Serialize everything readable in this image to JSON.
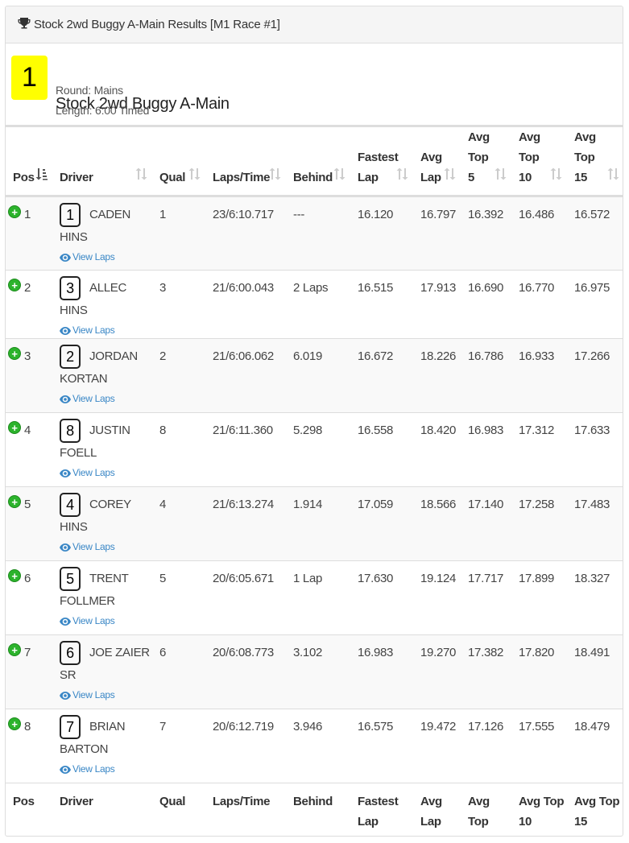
{
  "header": {
    "title": "Stock 2wd Buggy A-Main Results [M1 Race #1]",
    "icon": "trophy-icon"
  },
  "race": {
    "position_badge": "1",
    "badge_color": "#ffff00",
    "name": "Stock 2wd Buggy A-Main",
    "round": "Round: Mains",
    "length": "Length: 6:00 Timed"
  },
  "table": {
    "columns": [
      {
        "line1": "",
        "line2": "",
        "line3": "Pos"
      },
      {
        "line1": "",
        "line2": "",
        "line3": "Driver"
      },
      {
        "line1": "",
        "line2": "",
        "line3": "Qual"
      },
      {
        "line1": "",
        "line2": "",
        "line3": "Laps/Time"
      },
      {
        "line1": "",
        "line2": "",
        "line3": "Behind"
      },
      {
        "line1": "",
        "line2": "Fastest",
        "line3": "Lap"
      },
      {
        "line1": "",
        "line2": "Avg",
        "line3": "Lap"
      },
      {
        "line1": "Avg",
        "line2": "Top",
        "line3": "5"
      },
      {
        "line1": "Avg",
        "line2": "Top",
        "line3": "10"
      },
      {
        "line1": "Avg",
        "line2": "Top",
        "line3": "15"
      }
    ],
    "footer": [
      {
        "line1": "Pos",
        "line2": ""
      },
      {
        "line1": "Driver",
        "line2": ""
      },
      {
        "line1": "Qual",
        "line2": ""
      },
      {
        "line1": "Laps/Time",
        "line2": ""
      },
      {
        "line1": "Behind",
        "line2": ""
      },
      {
        "line1": "Fastest",
        "line2": "Lap"
      },
      {
        "line1": "Avg",
        "line2": "Lap"
      },
      {
        "line1": "Avg Top",
        "line2": "5"
      },
      {
        "line1": "Avg Top",
        "line2": "10"
      },
      {
        "line1": "Avg Top",
        "line2": "15"
      }
    ],
    "view_laps_label": "View Laps",
    "rows": [
      {
        "pos": "1",
        "car": "1",
        "driver": "CADEN HINS",
        "qual": "1",
        "laps": "23/6:10.717",
        "behind": "---",
        "fastest": "16.120",
        "avg": "16.797",
        "top5": "16.392",
        "top10": "16.486",
        "top15": "16.572"
      },
      {
        "pos": "2",
        "car": "3",
        "driver": "ALLEC HINS",
        "qual": "3",
        "laps": "21/6:00.043",
        "behind": "2 Laps",
        "fastest": "16.515",
        "avg": "17.913",
        "top5": "16.690",
        "top10": "16.770",
        "top15": "16.975"
      },
      {
        "pos": "3",
        "car": "2",
        "driver": "JORDAN KORTAN",
        "qual": "2",
        "laps": "21/6:06.062",
        "behind": "6.019",
        "fastest": "16.672",
        "avg": "18.226",
        "top5": "16.786",
        "top10": "16.933",
        "top15": "17.266"
      },
      {
        "pos": "4",
        "car": "8",
        "driver": "JUSTIN FOELL",
        "qual": "8",
        "laps": "21/6:11.360",
        "behind": "5.298",
        "fastest": "16.558",
        "avg": "18.420",
        "top5": "16.983",
        "top10": "17.312",
        "top15": "17.633"
      },
      {
        "pos": "5",
        "car": "4",
        "driver": "COREY HINS",
        "qual": "4",
        "laps": "21/6:13.274",
        "behind": "1.914",
        "fastest": "17.059",
        "avg": "18.566",
        "top5": "17.140",
        "top10": "17.258",
        "top15": "17.483"
      },
      {
        "pos": "6",
        "car": "5",
        "driver": "TRENT FOLLMER",
        "qual": "5",
        "laps": "20/6:05.671",
        "behind": "1 Lap",
        "fastest": "17.630",
        "avg": "19.124",
        "top5": "17.717",
        "top10": "17.899",
        "top15": "18.327"
      },
      {
        "pos": "7",
        "car": "6",
        "driver": "JOE ZAIER SR",
        "qual": "6",
        "laps": "20/6:08.773",
        "behind": "3.102",
        "fastest": "16.983",
        "avg": "19.270",
        "top5": "17.382",
        "top10": "17.820",
        "top15": "18.491"
      },
      {
        "pos": "8",
        "car": "7",
        "driver": "BRIAN BARTON",
        "qual": "7",
        "laps": "20/6:12.719",
        "behind": "3.946",
        "fastest": "16.575",
        "avg": "19.472",
        "top5": "17.126",
        "top10": "17.555",
        "top15": "18.479"
      }
    ]
  },
  "colors": {
    "expand_icon": "#2cb32c",
    "link": "#3a87c6",
    "stripe": "#f9f9f9",
    "border": "#dddddd"
  }
}
